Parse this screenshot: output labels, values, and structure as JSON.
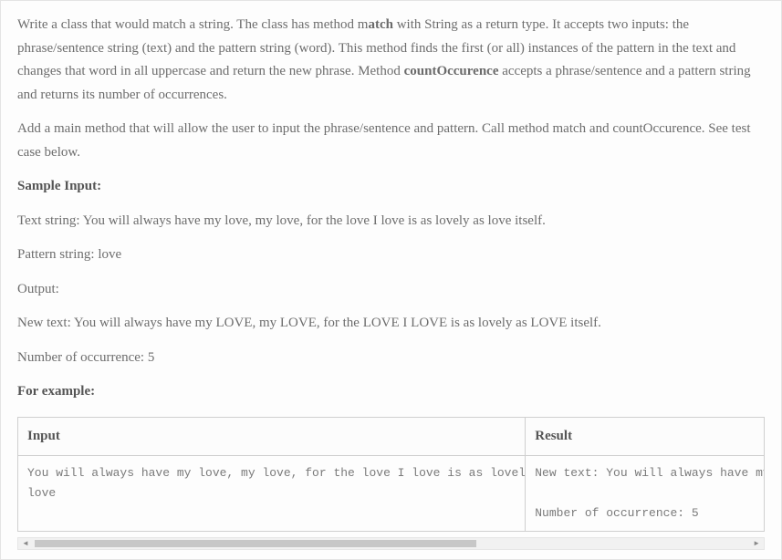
{
  "intro": {
    "p1_a": "Write a class that would match a string. The class has method  m",
    "p1_bold1": "atch",
    "p1_b": " with String as a return type.  It accepts two inputs: the phrase/sentence string (text) and the pattern string (word). This method finds the first (or all) instances of the pattern in the text and changes that word in all uppercase and return the new phrase. Method ",
    "p1_bold2": "countOccurence",
    "p1_c": " accepts a phrase/sentence and a pattern string and returns its number of occurrences.",
    "p2": "Add a main method that will allow the user to input the phrase/sentence and pattern. Call method match and countOccurence. See test case below."
  },
  "sample": {
    "heading": " Sample Input:",
    "text_line": "Text string: You will always have my love, my love, for the love I love is as lovely as love itself.",
    "pattern_line": "Pattern string: love",
    "output_label": "Output:",
    "new_text": "New text: You will always have my LOVE, my LOVE, for the LOVE I LOVE is as lovely as LOVE itself.",
    "occurrence": "Number of occurrence: 5"
  },
  "example_heading": "For example:",
  "table": {
    "headers": {
      "input": "Input",
      "result": "Result"
    },
    "row": {
      "input": "You will always have my love, my love, for the love I love is as lovely as love itself.\nlove",
      "result": "New text: You will always have my LOVE, my LOVE, for the LOVE I LOVE is as lovely as LOVE itself.\n\nNumber of occurrence: 5"
    }
  },
  "scrollbar": {
    "left_arrow": "◄",
    "right_arrow": "►"
  }
}
